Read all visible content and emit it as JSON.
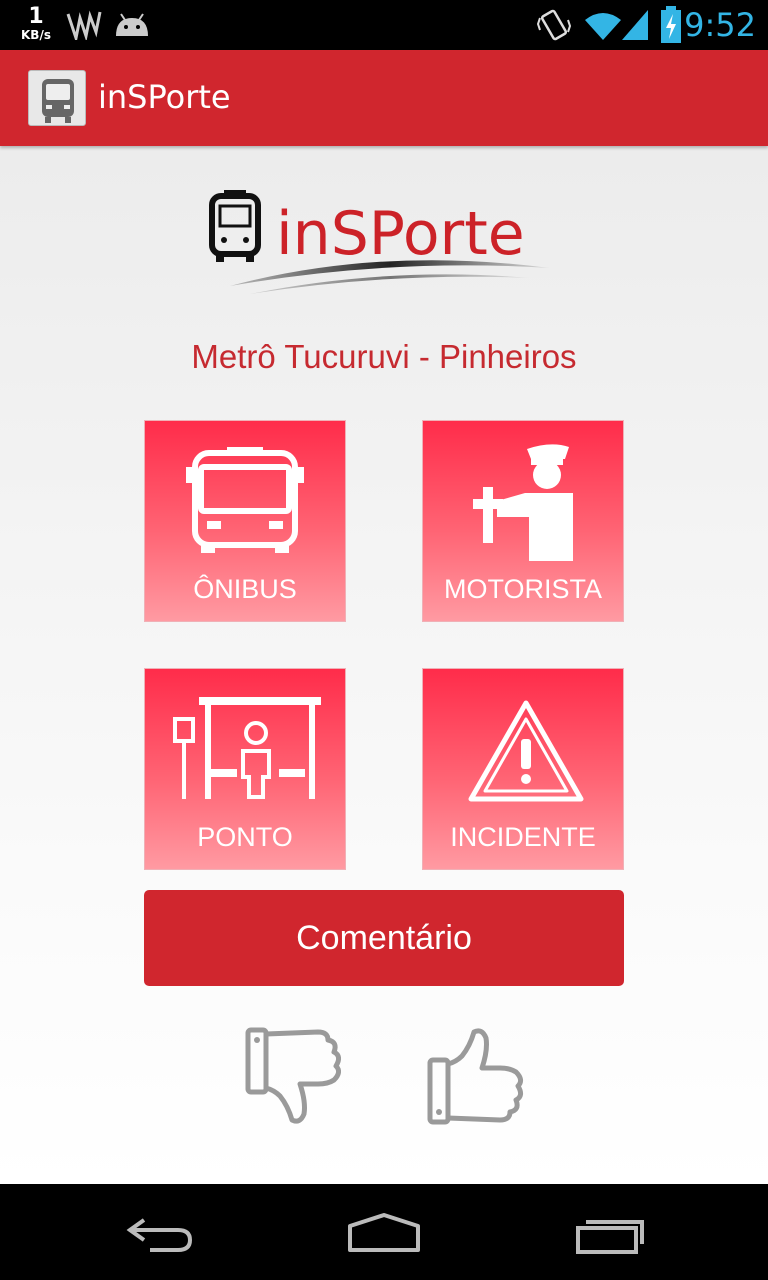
{
  "status_bar": {
    "net_speed": "1",
    "net_unit": "KB/s",
    "time": "9:52"
  },
  "app_bar": {
    "title": "inSPorte"
  },
  "logo": {
    "text": "inSPorte"
  },
  "route": {
    "name": "Metrô Tucuruvi - Pinheiros"
  },
  "menu": {
    "items": [
      {
        "label": "ÔNIBUS",
        "icon": "bus-icon"
      },
      {
        "label": "MOTORISTA",
        "icon": "driver-icon"
      },
      {
        "label": "PONTO",
        "icon": "bus-stop-icon"
      },
      {
        "label": "INCIDENTE",
        "icon": "warning-icon"
      }
    ]
  },
  "comment_button": {
    "label": "Comentário"
  },
  "rating": {
    "dislike_icon": "thumbs-down-icon",
    "like_icon": "thumbs-up-icon"
  },
  "colors": {
    "brand": "#d0262e",
    "tile_top": "#ff2c4a",
    "tile_bottom": "#ff9aa2",
    "clock": "#33b5e5"
  }
}
